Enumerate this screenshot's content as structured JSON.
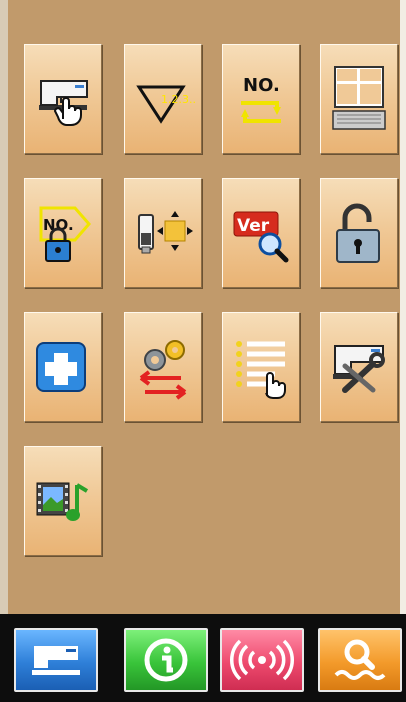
{
  "menu_tiles": [
    {
      "icon": "sewing-machine-touch-icon"
    },
    {
      "icon": "pattern-sequence-triangle-icon",
      "text": "1.2.3.."
    },
    {
      "icon": "pattern-number-cycle-icon",
      "text": "NO."
    },
    {
      "icon": "grid-window-keyboard-icon"
    },
    {
      "icon": "number-lock-icon",
      "text": "NO."
    },
    {
      "icon": "usb-transfer-icon"
    },
    {
      "icon": "version-search-icon",
      "text": "Ver"
    },
    {
      "icon": "padlock-open-icon"
    },
    {
      "icon": "medical-cross-icon"
    },
    {
      "icon": "gear-settings-exchange-icon"
    },
    {
      "icon": "list-touch-icon"
    },
    {
      "icon": "machine-wrench-icon"
    },
    {
      "icon": "film-music-icon"
    }
  ],
  "bottom_nav": [
    {
      "icon": "sewing-machine-icon",
      "color": "#2e7fd8"
    },
    {
      "icon": "info-icon",
      "color": "#39c43a"
    },
    {
      "icon": "signal-wave-icon",
      "color": "#ee4a6e"
    },
    {
      "icon": "magnifier-wave-icon",
      "color": "#f39a2a"
    }
  ],
  "colors": {
    "panel": "#c19a6b",
    "tile_light": "#f6ddb8",
    "tile_dark": "#e9b374",
    "bar": "#0d0d0d"
  }
}
